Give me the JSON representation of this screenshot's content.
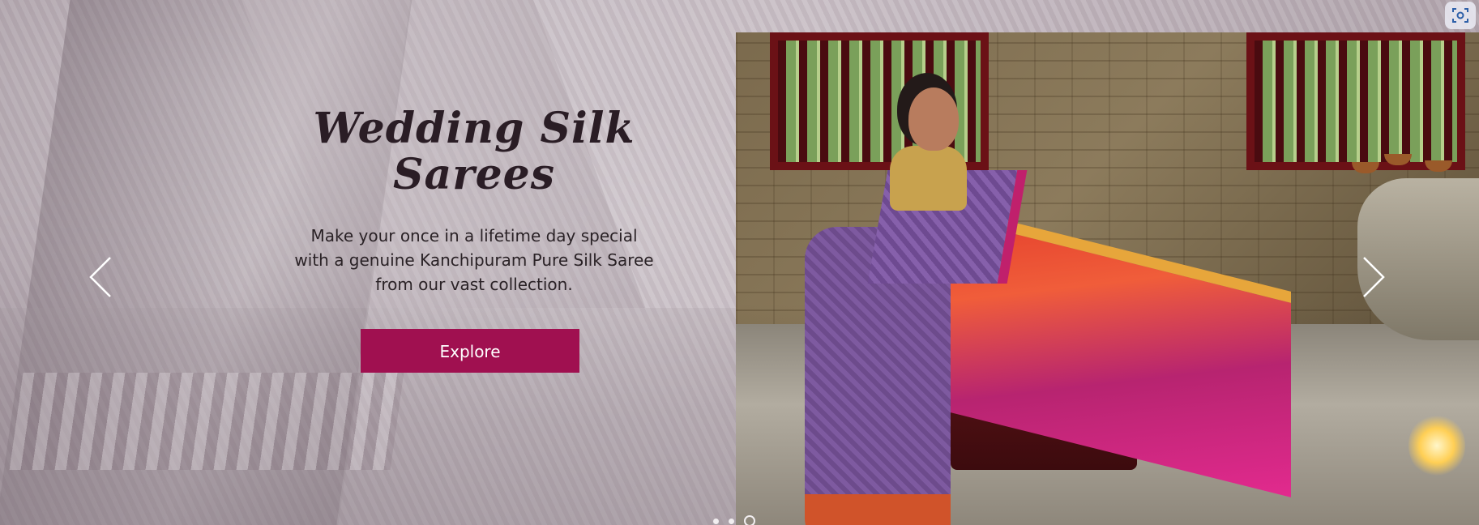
{
  "hero": {
    "title": "Wedding Silk Sarees",
    "description": "Make your once in a lifetime day special with a genuine Kanchipuram Pure Silk Saree from our vast collection.",
    "cta_label": "Explore",
    "accent_color": "#a01050"
  },
  "carousel": {
    "prev_icon": "chevron-left-icon",
    "next_icon": "chevron-right-icon",
    "slide_count": 3,
    "active_slide": 3
  },
  "toolbar": {
    "screenshot_icon": "screenshot-icon"
  }
}
